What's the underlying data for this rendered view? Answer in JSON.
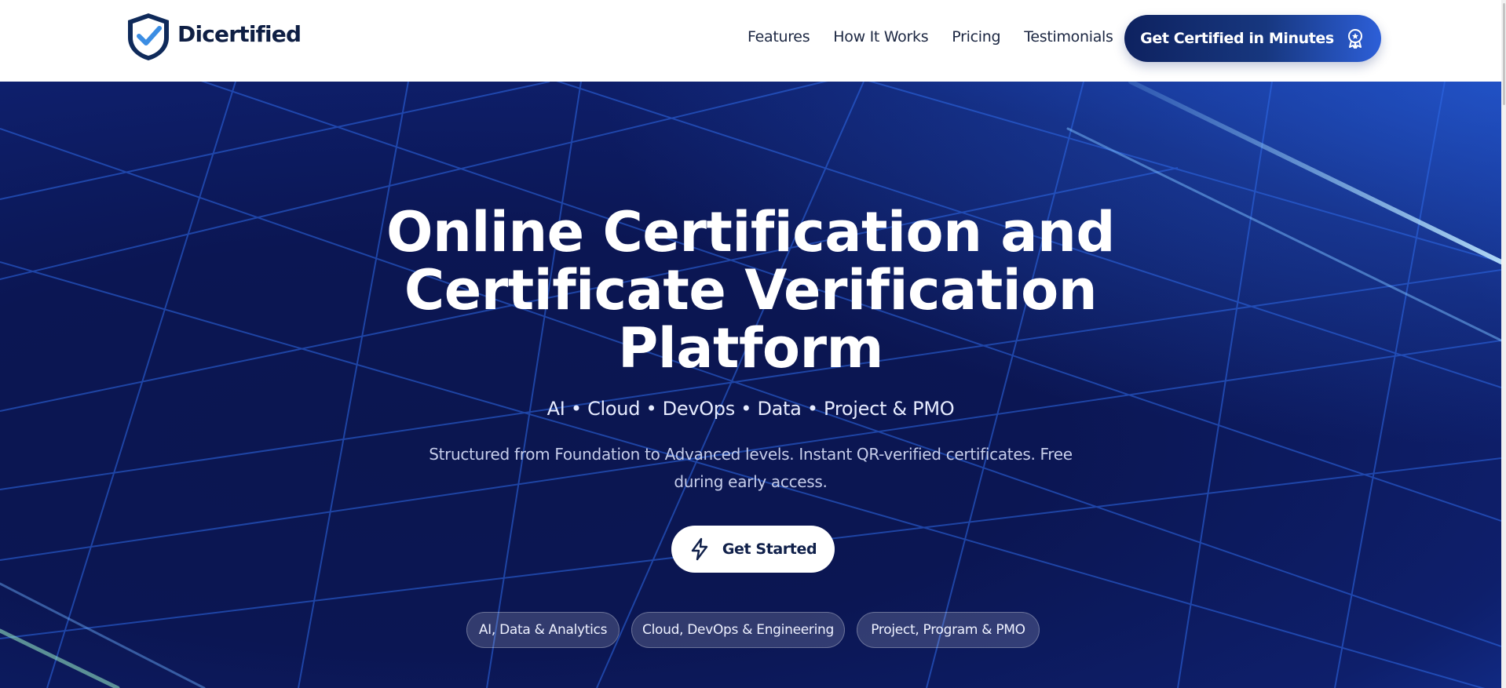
{
  "brand": {
    "name": "Dicertified",
    "logo_icon": "shield-check-icon"
  },
  "nav": {
    "items": [
      {
        "label": "Features"
      },
      {
        "label": "How It Works"
      },
      {
        "label": "Pricing"
      },
      {
        "label": "Testimonials"
      }
    ],
    "cta_label": "Get Certified in Minutes",
    "cta_icon": "award-badge-icon"
  },
  "hero": {
    "title_lines": [
      "Online Certification and",
      "Certificate Verification",
      "Platform"
    ],
    "subtitle": "AI • Cloud • DevOps • Data • Project & PMO",
    "description": "Structured from Foundation to Advanced levels. Instant QR-verified certificates. Free during early access.",
    "button_label": "Get Started",
    "button_icon": "lightning-bolt-icon",
    "chips": [
      {
        "label": "AI, Data & Analytics"
      },
      {
        "label": "Cloud, DevOps & Engineering"
      },
      {
        "label": "Project, Program & PMO"
      }
    ]
  },
  "colors": {
    "hero_bg": "#0b1653",
    "accent_blue": "#2d5fd8",
    "brand_dark": "#0f1f44",
    "white": "#ffffff"
  }
}
